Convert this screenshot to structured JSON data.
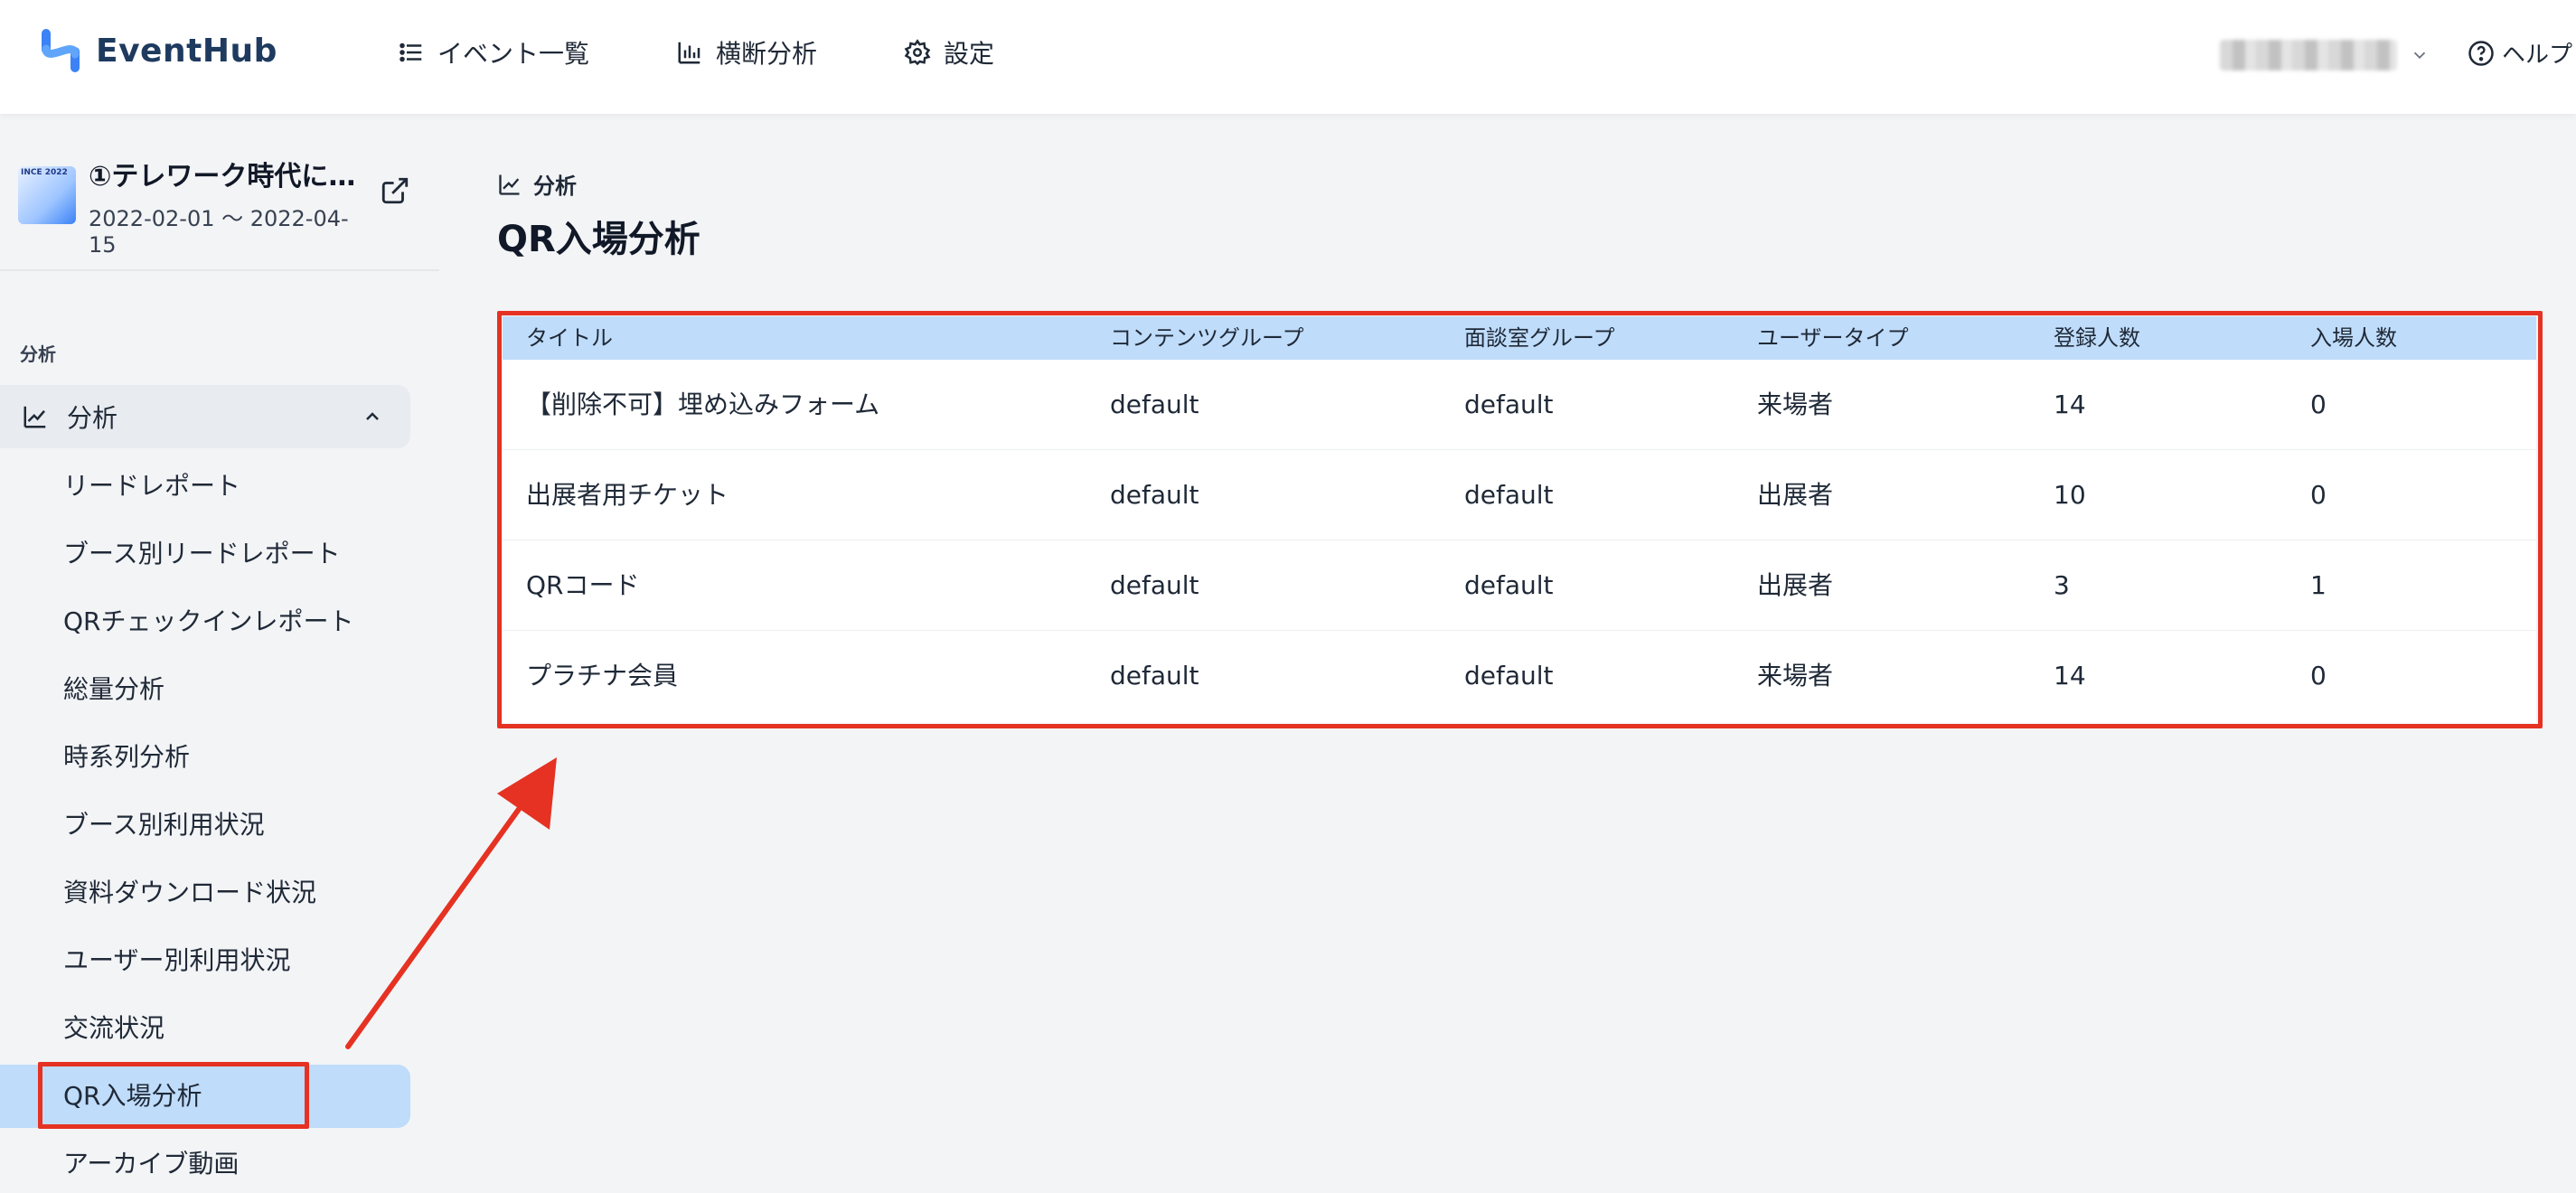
{
  "header": {
    "logo_text": "EventHub",
    "nav": [
      {
        "label": "イベント一覧",
        "icon": "list-icon"
      },
      {
        "label": "横断分析",
        "icon": "bar-chart-icon"
      },
      {
        "label": "設定",
        "icon": "gear-icon"
      }
    ],
    "help_label": "ヘルプ"
  },
  "sidebar": {
    "event_title": "①テレワーク時代に…",
    "event_dates": "2022-02-01 ～ 2022-04-15",
    "section_label": "分析",
    "group_label": "分析",
    "items": [
      "リードレポート",
      "ブース別リードレポート",
      "QRチェックインレポート",
      "総量分析",
      "時系列分析",
      "ブース別利用状況",
      "資料ダウンロード状況",
      "ユーザー別利用状況",
      "交流状況",
      "QR入場分析",
      "アーカイブ動画"
    ],
    "active_item": "QR入場分析"
  },
  "main": {
    "breadcrumb": "分析",
    "title": "QR入場分析",
    "table": {
      "headers": [
        "タイトル",
        "コンテンツグループ",
        "面談室グループ",
        "ユーザータイプ",
        "登録人数",
        "入場人数"
      ],
      "rows": [
        [
          "【削除不可】埋め込みフォーム",
          "default",
          "default",
          "来場者",
          "14",
          "0"
        ],
        [
          "出展者用チケット",
          "default",
          "default",
          "出展者",
          "10",
          "0"
        ],
        [
          "QRコード",
          "default",
          "default",
          "出展者",
          "3",
          "1"
        ],
        [
          "プラチナ会員",
          "default",
          "default",
          "来場者",
          "14",
          "0"
        ]
      ]
    }
  },
  "colors": {
    "highlight": "#e53222",
    "active_bg": "#bfdcfa",
    "brand": "#1e3a5f"
  }
}
